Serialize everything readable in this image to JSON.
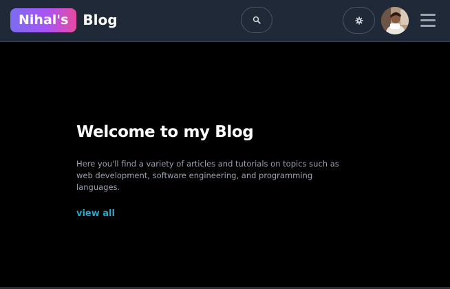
{
  "header": {
    "brand_badge": "Nihal's",
    "brand_text": "Blog",
    "search_icon": "search-icon",
    "theme_icon": "gear-icon",
    "menu_icon": "hamburger-menu-icon"
  },
  "hero": {
    "title": "Welcome to my Blog",
    "description": "Here you'll find a variety of articles and tutorials on topics such as web development, software engineering, and programming languages.",
    "link_label": "view all"
  },
  "colors": {
    "background": "#000000",
    "navbar": "#1f2937",
    "accent_link": "#2aa8c9",
    "brand_gradient_start": "#7c6cf0",
    "brand_gradient_end": "#e84aa0"
  }
}
